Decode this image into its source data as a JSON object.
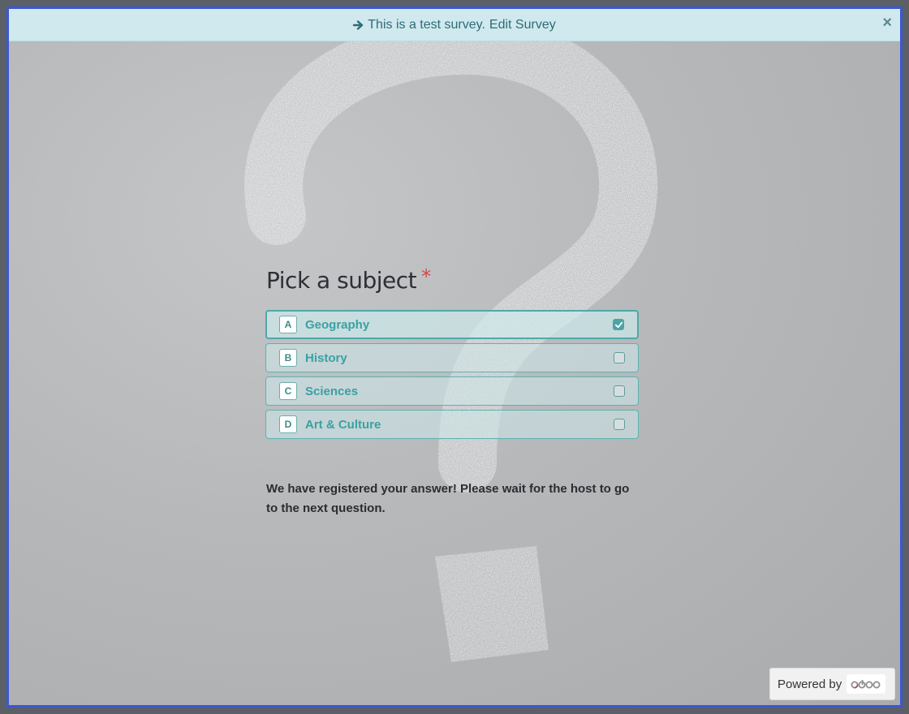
{
  "banner": {
    "prefix": "This is a test survey.",
    "link": "Edit Survey",
    "arrow_icon": "arrow-right-icon",
    "close_icon": "close-icon",
    "close_glyph": "×"
  },
  "question": {
    "title": "Pick a subject",
    "required_mark": "*"
  },
  "options": [
    {
      "key": "A",
      "label": "Geography",
      "checked": true
    },
    {
      "key": "B",
      "label": "History",
      "checked": false
    },
    {
      "key": "C",
      "label": "Sciences",
      "checked": false
    },
    {
      "key": "D",
      "label": "Art & Culture",
      "checked": false
    }
  ],
  "message": "We have registered your answer! Please wait for the host to go to the next question.",
  "footer": {
    "powered_by": "Powered by",
    "brand": "odoo"
  },
  "colors": {
    "accent": "#3aa1a3",
    "banner_bg": "#cfe9ee",
    "frame_border": "#3b57d6",
    "required": "#d64848"
  }
}
